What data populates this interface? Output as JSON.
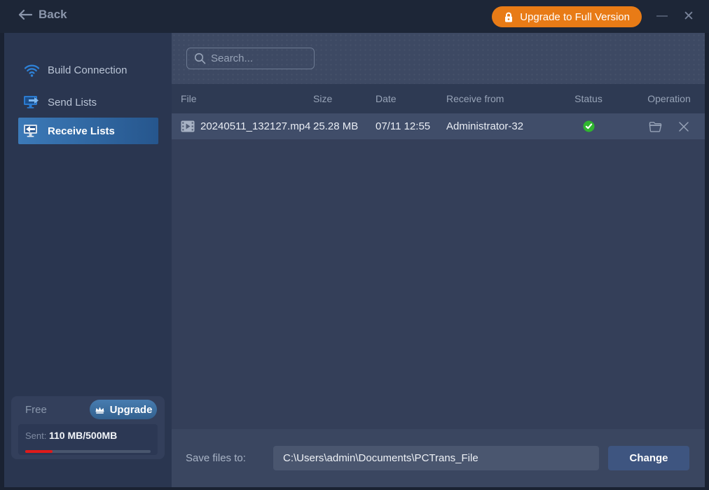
{
  "topbar": {
    "back_label": "Back",
    "upgrade_label": "Upgrade to Full Version",
    "minimize_glyph": "—",
    "close_glyph": "✕"
  },
  "sidebar": {
    "items": [
      {
        "label": "Build Connection",
        "icon": "wifi-icon",
        "selected": false
      },
      {
        "label": "Send Lists",
        "icon": "monitor-send-icon",
        "selected": false
      },
      {
        "label": "Receive Lists",
        "icon": "monitor-receive-icon",
        "selected": true
      }
    ],
    "plan": {
      "tier_label": "Free",
      "upgrade_label": "Upgrade",
      "sent_label": "Sent:",
      "sent_value": "110 MB/500MB",
      "quota_used_mb": 110,
      "quota_total_mb": 500,
      "progress_percent": 22,
      "progress_color": "#e01a1a"
    }
  },
  "main": {
    "search": {
      "placeholder": "Search..."
    },
    "table": {
      "columns": [
        "File",
        "Size",
        "Date",
        "Receive from",
        "Status",
        "Operation"
      ],
      "rows": [
        {
          "file_name": "20240511_132127.mp4",
          "file_type": "video",
          "size": "25.28 MB",
          "date": "07/11 12:55",
          "receive_from": "Administrator-32",
          "status": "success",
          "operations": [
            "open-folder",
            "delete"
          ]
        }
      ]
    },
    "footer": {
      "save_label": "Save files to:",
      "path_value": "C:\\Users\\admin\\Documents\\PCTrans_File",
      "change_label": "Change"
    }
  },
  "colors": {
    "accent_orange": "#e87b16",
    "selected_blue": "#3c7ab8",
    "success_green": "#2fb52f",
    "progress_red": "#e01a1a"
  }
}
